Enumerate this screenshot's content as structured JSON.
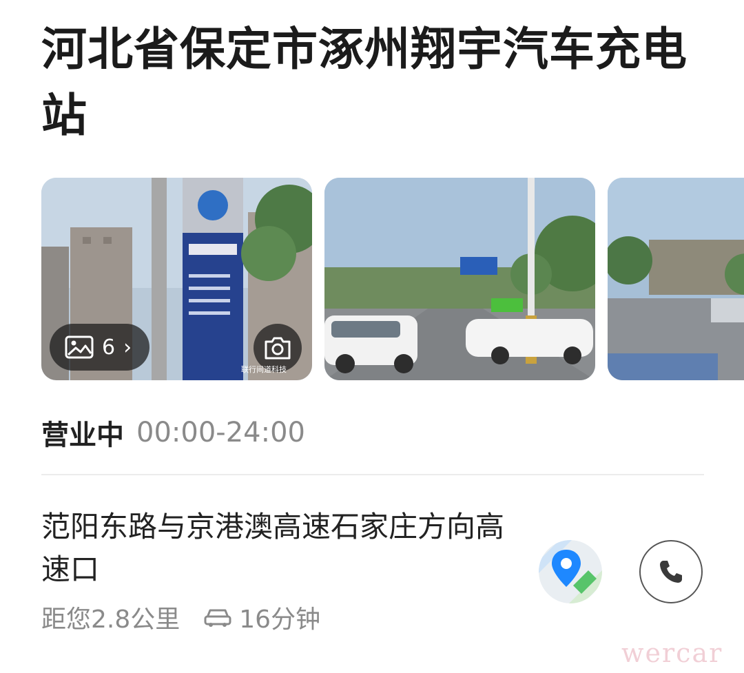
{
  "station": {
    "title": "河北省保定市涿州翔宇汽车充电站"
  },
  "gallery": {
    "photo_count": "6",
    "chevron": "›",
    "photo_credit": "联行间道科技"
  },
  "hours": {
    "status": "营业中",
    "time": "00:00-24:00"
  },
  "address": {
    "text": "范阳东路与京港澳高速石家庄方向高速口"
  },
  "route": {
    "distance": "距您2.8公里",
    "drive_time": "16分钟"
  },
  "icons": {
    "gallery": "image-icon",
    "camera": "camera-icon",
    "car": "car-icon",
    "navigation": "map-pin-icon",
    "call": "phone-icon"
  },
  "colors": {
    "title": "#1b1b1b",
    "muted": "#8a8a8a",
    "divider": "#ececec",
    "pin_blue": "#1e88ff",
    "pin_green": "#57c46a"
  },
  "watermark": "wercar"
}
